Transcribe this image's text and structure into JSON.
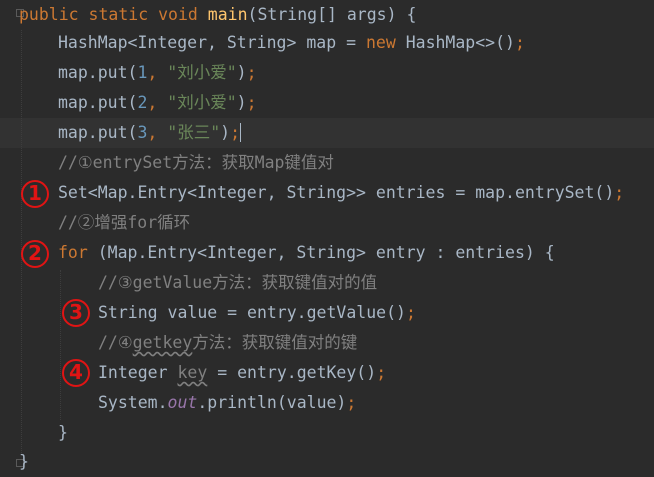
{
  "code": {
    "l1": {
      "kw1": "public",
      "kw2": "static",
      "kw3": "void",
      "method": "main",
      "params": "(String[] args) {"
    },
    "l2": {
      "pre": "HashMap<Integer, String> map = ",
      "kw": "new",
      "post": " HashMap<>()",
      "semi": ";"
    },
    "l3": {
      "pre": "map.put(",
      "num": "1",
      "sep": ", ",
      "str": "\"刘小爱\"",
      "post": ")",
      "semi": ";"
    },
    "l4": {
      "pre": "map.put(",
      "num": "2",
      "sep": ", ",
      "str": "\"刘小爱\"",
      "post": ")",
      "semi": ";"
    },
    "l5": {
      "pre": "map.put(",
      "num": "3",
      "sep": ", ",
      "str": "\"张三\"",
      "post": ")",
      "semi": ";"
    },
    "l6": {
      "comment": "//①entrySet方法：获取Map键值对"
    },
    "l7": {
      "code": "Set<Map.Entry<Integer, String>> entries = map.entrySet()",
      "semi": ";"
    },
    "l8": {
      "comment": "//②增强for循环"
    },
    "l9": {
      "kw": "for",
      "code": " (Map.Entry<Integer, String> entry : entries) {"
    },
    "l10": {
      "comment": "//③getValue方法：获取键值对的值"
    },
    "l11": {
      "code": "String value = entry.getValue()",
      "semi": ";"
    },
    "l12": {
      "prefix": "//④",
      "underlined": "getkey",
      "rest": "方法：获取键值对的键"
    },
    "l13": {
      "pre": "Integer ",
      "var": "key",
      "post": " = entry.getKey()",
      "semi": ";"
    },
    "l14": {
      "pre": "System.",
      "field": "out",
      "post": ".println(value)",
      "semi": ";"
    },
    "l15": {
      "brace": "}"
    },
    "l16": {
      "brace": "}"
    }
  },
  "annotations": {
    "a1": "1",
    "a2": "2",
    "a3": "3",
    "a4": "4"
  }
}
